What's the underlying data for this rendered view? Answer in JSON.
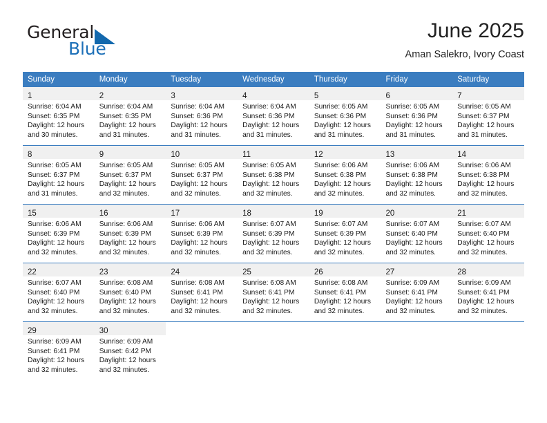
{
  "brand": {
    "word_one": "General",
    "word_two": "Blue",
    "triangle_icon": "triangle-logo-icon",
    "accent_color": "#1268ad"
  },
  "header": {
    "title": "June 2025",
    "subtitle": "Aman Salekro, Ivory Coast"
  },
  "theme": {
    "header_bg": "#3b7dc0",
    "daynum_bg": "#f0f0f0",
    "text": "#1a1a1a"
  },
  "calendar": {
    "weekday_headers": [
      "Sunday",
      "Monday",
      "Tuesday",
      "Wednesday",
      "Thursday",
      "Friday",
      "Saturday"
    ],
    "weeks": [
      [
        {
          "day": "1",
          "sunrise": "Sunrise: 6:04 AM",
          "sunset": "Sunset: 6:35 PM",
          "daylight_1": "Daylight: 12 hours",
          "daylight_2": "and 30 minutes."
        },
        {
          "day": "2",
          "sunrise": "Sunrise: 6:04 AM",
          "sunset": "Sunset: 6:35 PM",
          "daylight_1": "Daylight: 12 hours",
          "daylight_2": "and 31 minutes."
        },
        {
          "day": "3",
          "sunrise": "Sunrise: 6:04 AM",
          "sunset": "Sunset: 6:36 PM",
          "daylight_1": "Daylight: 12 hours",
          "daylight_2": "and 31 minutes."
        },
        {
          "day": "4",
          "sunrise": "Sunrise: 6:04 AM",
          "sunset": "Sunset: 6:36 PM",
          "daylight_1": "Daylight: 12 hours",
          "daylight_2": "and 31 minutes."
        },
        {
          "day": "5",
          "sunrise": "Sunrise: 6:05 AM",
          "sunset": "Sunset: 6:36 PM",
          "daylight_1": "Daylight: 12 hours",
          "daylight_2": "and 31 minutes."
        },
        {
          "day": "6",
          "sunrise": "Sunrise: 6:05 AM",
          "sunset": "Sunset: 6:36 PM",
          "daylight_1": "Daylight: 12 hours",
          "daylight_2": "and 31 minutes."
        },
        {
          "day": "7",
          "sunrise": "Sunrise: 6:05 AM",
          "sunset": "Sunset: 6:37 PM",
          "daylight_1": "Daylight: 12 hours",
          "daylight_2": "and 31 minutes."
        }
      ],
      [
        {
          "day": "8",
          "sunrise": "Sunrise: 6:05 AM",
          "sunset": "Sunset: 6:37 PM",
          "daylight_1": "Daylight: 12 hours",
          "daylight_2": "and 31 minutes."
        },
        {
          "day": "9",
          "sunrise": "Sunrise: 6:05 AM",
          "sunset": "Sunset: 6:37 PM",
          "daylight_1": "Daylight: 12 hours",
          "daylight_2": "and 32 minutes."
        },
        {
          "day": "10",
          "sunrise": "Sunrise: 6:05 AM",
          "sunset": "Sunset: 6:37 PM",
          "daylight_1": "Daylight: 12 hours",
          "daylight_2": "and 32 minutes."
        },
        {
          "day": "11",
          "sunrise": "Sunrise: 6:05 AM",
          "sunset": "Sunset: 6:38 PM",
          "daylight_1": "Daylight: 12 hours",
          "daylight_2": "and 32 minutes."
        },
        {
          "day": "12",
          "sunrise": "Sunrise: 6:06 AM",
          "sunset": "Sunset: 6:38 PM",
          "daylight_1": "Daylight: 12 hours",
          "daylight_2": "and 32 minutes."
        },
        {
          "day": "13",
          "sunrise": "Sunrise: 6:06 AM",
          "sunset": "Sunset: 6:38 PM",
          "daylight_1": "Daylight: 12 hours",
          "daylight_2": "and 32 minutes."
        },
        {
          "day": "14",
          "sunrise": "Sunrise: 6:06 AM",
          "sunset": "Sunset: 6:38 PM",
          "daylight_1": "Daylight: 12 hours",
          "daylight_2": "and 32 minutes."
        }
      ],
      [
        {
          "day": "15",
          "sunrise": "Sunrise: 6:06 AM",
          "sunset": "Sunset: 6:39 PM",
          "daylight_1": "Daylight: 12 hours",
          "daylight_2": "and 32 minutes."
        },
        {
          "day": "16",
          "sunrise": "Sunrise: 6:06 AM",
          "sunset": "Sunset: 6:39 PM",
          "daylight_1": "Daylight: 12 hours",
          "daylight_2": "and 32 minutes."
        },
        {
          "day": "17",
          "sunrise": "Sunrise: 6:06 AM",
          "sunset": "Sunset: 6:39 PM",
          "daylight_1": "Daylight: 12 hours",
          "daylight_2": "and 32 minutes."
        },
        {
          "day": "18",
          "sunrise": "Sunrise: 6:07 AM",
          "sunset": "Sunset: 6:39 PM",
          "daylight_1": "Daylight: 12 hours",
          "daylight_2": "and 32 minutes."
        },
        {
          "day": "19",
          "sunrise": "Sunrise: 6:07 AM",
          "sunset": "Sunset: 6:39 PM",
          "daylight_1": "Daylight: 12 hours",
          "daylight_2": "and 32 minutes."
        },
        {
          "day": "20",
          "sunrise": "Sunrise: 6:07 AM",
          "sunset": "Sunset: 6:40 PM",
          "daylight_1": "Daylight: 12 hours",
          "daylight_2": "and 32 minutes."
        },
        {
          "day": "21",
          "sunrise": "Sunrise: 6:07 AM",
          "sunset": "Sunset: 6:40 PM",
          "daylight_1": "Daylight: 12 hours",
          "daylight_2": "and 32 minutes."
        }
      ],
      [
        {
          "day": "22",
          "sunrise": "Sunrise: 6:07 AM",
          "sunset": "Sunset: 6:40 PM",
          "daylight_1": "Daylight: 12 hours",
          "daylight_2": "and 32 minutes."
        },
        {
          "day": "23",
          "sunrise": "Sunrise: 6:08 AM",
          "sunset": "Sunset: 6:40 PM",
          "daylight_1": "Daylight: 12 hours",
          "daylight_2": "and 32 minutes."
        },
        {
          "day": "24",
          "sunrise": "Sunrise: 6:08 AM",
          "sunset": "Sunset: 6:41 PM",
          "daylight_1": "Daylight: 12 hours",
          "daylight_2": "and 32 minutes."
        },
        {
          "day": "25",
          "sunrise": "Sunrise: 6:08 AM",
          "sunset": "Sunset: 6:41 PM",
          "daylight_1": "Daylight: 12 hours",
          "daylight_2": "and 32 minutes."
        },
        {
          "day": "26",
          "sunrise": "Sunrise: 6:08 AM",
          "sunset": "Sunset: 6:41 PM",
          "daylight_1": "Daylight: 12 hours",
          "daylight_2": "and 32 minutes."
        },
        {
          "day": "27",
          "sunrise": "Sunrise: 6:09 AM",
          "sunset": "Sunset: 6:41 PM",
          "daylight_1": "Daylight: 12 hours",
          "daylight_2": "and 32 minutes."
        },
        {
          "day": "28",
          "sunrise": "Sunrise: 6:09 AM",
          "sunset": "Sunset: 6:41 PM",
          "daylight_1": "Daylight: 12 hours",
          "daylight_2": "and 32 minutes."
        }
      ],
      [
        {
          "day": "29",
          "sunrise": "Sunrise: 6:09 AM",
          "sunset": "Sunset: 6:41 PM",
          "daylight_1": "Daylight: 12 hours",
          "daylight_2": "and 32 minutes."
        },
        {
          "day": "30",
          "sunrise": "Sunrise: 6:09 AM",
          "sunset": "Sunset: 6:42 PM",
          "daylight_1": "Daylight: 12 hours",
          "daylight_2": "and 32 minutes."
        },
        {
          "day": "",
          "sunrise": "",
          "sunset": "",
          "daylight_1": "",
          "daylight_2": ""
        },
        {
          "day": "",
          "sunrise": "",
          "sunset": "",
          "daylight_1": "",
          "daylight_2": ""
        },
        {
          "day": "",
          "sunrise": "",
          "sunset": "",
          "daylight_1": "",
          "daylight_2": ""
        },
        {
          "day": "",
          "sunrise": "",
          "sunset": "",
          "daylight_1": "",
          "daylight_2": ""
        },
        {
          "day": "",
          "sunrise": "",
          "sunset": "",
          "daylight_1": "",
          "daylight_2": ""
        }
      ]
    ]
  }
}
